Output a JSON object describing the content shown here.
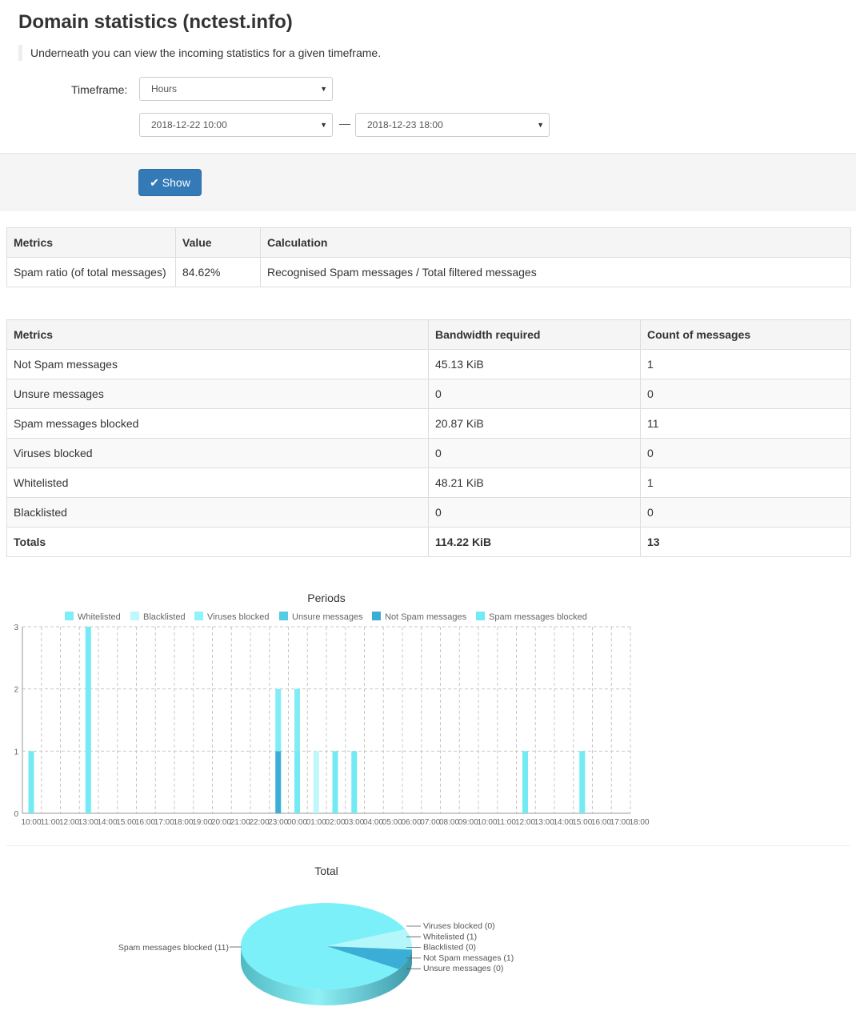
{
  "page": {
    "title": "Domain statistics (nctest.info)",
    "lead": "Underneath you can view the incoming statistics for a given timeframe."
  },
  "form": {
    "timeframe_label": "Timeframe:",
    "timeframe_value": "Hours",
    "from_value": "2018-12-22 10:00",
    "range_separator": "—",
    "to_value": "2018-12-23 18:00",
    "show_label": "Show",
    "show_icon": "check-icon"
  },
  "ratio_table": {
    "headers": [
      "Metrics",
      "Value",
      "Calculation"
    ],
    "rows": [
      [
        "Spam ratio (of total messages)",
        "84.62%",
        "Recognised Spam messages / Total filtered messages"
      ]
    ]
  },
  "stats_table": {
    "headers": [
      "Metrics",
      "Bandwidth required",
      "Count of messages"
    ],
    "rows": [
      [
        "Not Spam messages",
        "45.13 KiB",
        "1"
      ],
      [
        "Unsure messages",
        "0",
        "0"
      ],
      [
        "Spam messages blocked",
        "20.87 KiB",
        "11"
      ],
      [
        "Viruses blocked",
        "0",
        "0"
      ],
      [
        "Whitelisted",
        "48.21 KiB",
        "1"
      ],
      [
        "Blacklisted",
        "0",
        "0"
      ]
    ],
    "totals": [
      "Totals",
      "114.22 KiB",
      "13"
    ]
  },
  "chart_data": [
    {
      "type": "bar",
      "stacked": true,
      "title": "Periods",
      "grid": true,
      "legend_position": "top",
      "ylim": [
        0,
        3
      ],
      "yticks": [
        "0",
        "1",
        "2",
        "3"
      ],
      "categories": [
        "10:00",
        "11:00",
        "12:00",
        "13:00",
        "14:00",
        "15:00",
        "16:00",
        "17:00",
        "18:00",
        "19:00",
        "20:00",
        "21:00",
        "22:00",
        "23:00",
        "00:00",
        "01:00",
        "02:00",
        "03:00",
        "04:00",
        "05:00",
        "06:00",
        "07:00",
        "08:00",
        "09:00",
        "10:00",
        "11:00",
        "12:00",
        "13:00",
        "14:00",
        "15:00",
        "16:00",
        "17:00",
        "18:00"
      ],
      "series": [
        {
          "name": "Whitelisted",
          "color": "#80ecf6",
          "values": [
            0,
            0,
            0,
            0,
            0,
            0,
            0,
            0,
            0,
            0,
            0,
            0,
            0,
            1,
            1,
            0,
            0,
            0,
            0,
            0,
            0,
            0,
            0,
            0,
            0,
            0,
            0,
            0,
            0,
            0,
            0,
            0,
            0
          ]
        },
        {
          "name": "Blacklisted",
          "color": "#bff8fb",
          "values": [
            0,
            0,
            0,
            0,
            0,
            0,
            0,
            0,
            0,
            0,
            0,
            0,
            0,
            0,
            0,
            1,
            0,
            0,
            0,
            0,
            0,
            0,
            0,
            0,
            0,
            0,
            0,
            0,
            0,
            0,
            0,
            0,
            0
          ]
        },
        {
          "name": "Viruses blocked",
          "color": "#8ff3fb",
          "values": [
            0,
            0,
            0,
            0,
            0,
            0,
            0,
            0,
            0,
            0,
            0,
            0,
            0,
            0,
            0,
            0,
            0,
            0,
            0,
            0,
            0,
            0,
            0,
            0,
            0,
            0,
            0,
            0,
            0,
            0,
            0,
            0,
            0
          ]
        },
        {
          "name": "Unsure messages",
          "color": "#55cce3",
          "values": [
            0,
            0,
            0,
            0,
            0,
            0,
            0,
            0,
            0,
            0,
            0,
            0,
            0,
            0,
            0,
            0,
            0,
            0,
            0,
            0,
            0,
            0,
            0,
            0,
            0,
            0,
            0,
            0,
            0,
            0,
            0,
            0,
            0
          ]
        },
        {
          "name": "Not Spam messages",
          "color": "#3aaed6",
          "values": [
            0,
            0,
            0,
            0,
            0,
            0,
            0,
            0,
            0,
            0,
            0,
            0,
            0,
            1,
            0,
            0,
            0,
            0,
            0,
            0,
            0,
            0,
            0,
            0,
            0,
            0,
            0,
            0,
            0,
            0,
            0,
            0,
            0
          ]
        },
        {
          "name": "Spam messages blocked",
          "color": "#74eaf5",
          "values": [
            1,
            0,
            0,
            3,
            0,
            0,
            0,
            0,
            0,
            0,
            0,
            0,
            0,
            0,
            1,
            0,
            1,
            1,
            0,
            0,
            0,
            0,
            0,
            0,
            0,
            0,
            1,
            0,
            0,
            1,
            0,
            0,
            0
          ]
        }
      ]
    },
    {
      "type": "pie",
      "title": "Total",
      "slices": [
        {
          "label": "Viruses blocked (0)",
          "value": 0,
          "color": "#8ff3fb"
        },
        {
          "label": "Whitelisted (1)",
          "value": 1,
          "color": "#b3f7fb"
        },
        {
          "label": "Blacklisted (0)",
          "value": 0,
          "color": "#bff8fb"
        },
        {
          "label": "Not Spam messages (1)",
          "value": 1,
          "color": "#3aaed6"
        },
        {
          "label": "Unsure messages (0)",
          "value": 0,
          "color": "#55cce3"
        },
        {
          "label": "Spam messages blocked (11)",
          "value": 11,
          "color": "#7bf0f9"
        }
      ]
    }
  ]
}
